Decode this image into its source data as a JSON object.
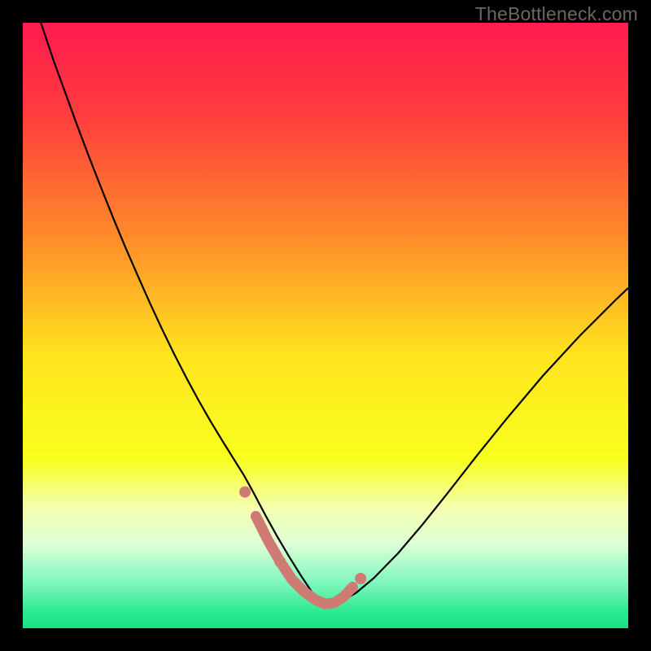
{
  "watermark": "TheBottleneck.com",
  "chart_data": {
    "type": "line",
    "title": "",
    "xlabel": "",
    "ylabel": "",
    "xlim": [
      0,
      100
    ],
    "ylim": [
      0,
      100
    ],
    "grid": false,
    "axes_visible": false,
    "background_gradient": {
      "stops": [
        {
          "pos": 0.0,
          "color": "#ff1b4e"
        },
        {
          "pos": 0.15,
          "color": "#ff3c3e"
        },
        {
          "pos": 0.35,
          "color": "#ff8a2a"
        },
        {
          "pos": 0.55,
          "color": "#ffe41e"
        },
        {
          "pos": 0.72,
          "color": "#f8ff1e"
        },
        {
          "pos": 0.8,
          "color": "#f4ffad"
        },
        {
          "pos": 0.86,
          "color": "#deffd6"
        },
        {
          "pos": 0.92,
          "color": "#86f7c0"
        },
        {
          "pos": 0.975,
          "color": "#29e98f"
        },
        {
          "pos": 1.0,
          "color": "#19e183"
        }
      ]
    },
    "series": [
      {
        "name": "curve",
        "color": "#000000",
        "width": 2.2,
        "x": [
          3,
          5,
          7,
          9,
          11,
          13,
          15,
          17,
          19,
          21,
          23,
          25,
          27,
          29,
          31,
          33,
          35,
          36.5,
          38,
          40,
          42,
          44,
          46,
          48,
          49.5,
          52,
          55,
          58,
          62,
          66,
          70,
          75,
          80,
          86,
          92,
          98,
          100
        ],
        "y": [
          100,
          94,
          88.5,
          83,
          77.7,
          72.6,
          67.6,
          62.8,
          58.2,
          53.7,
          49.4,
          45.3,
          41.4,
          37.7,
          34.2,
          30.9,
          27.7,
          25.3,
          22.6,
          18.8,
          15.2,
          11.8,
          8.6,
          5.6,
          4,
          4.1,
          5.8,
          8.3,
          12.4,
          17.1,
          22.1,
          28.5,
          34.7,
          41.8,
          48.3,
          54.3,
          56.2
        ]
      },
      {
        "name": "highlight",
        "color": "#cf7a73",
        "width": 13,
        "linecap": "round",
        "x": [
          38.5,
          40.5,
          42.5,
          44.5,
          46.5,
          48.5,
          50,
          51.5,
          53,
          54.5
        ],
        "y": [
          18.5,
          14.5,
          11.0,
          8.0,
          6.0,
          4.6,
          4.0,
          4.2,
          5.2,
          6.8
        ]
      }
    ],
    "markers": [
      {
        "x": 36.7,
        "y": 22.5,
        "r": 7,
        "color": "#cf7a73"
      },
      {
        "x": 42.5,
        "y": 11.0,
        "r": 7,
        "color": "#cf7a73"
      },
      {
        "x": 55.8,
        "y": 8.2,
        "r": 7,
        "color": "#cf7a73"
      }
    ]
  }
}
